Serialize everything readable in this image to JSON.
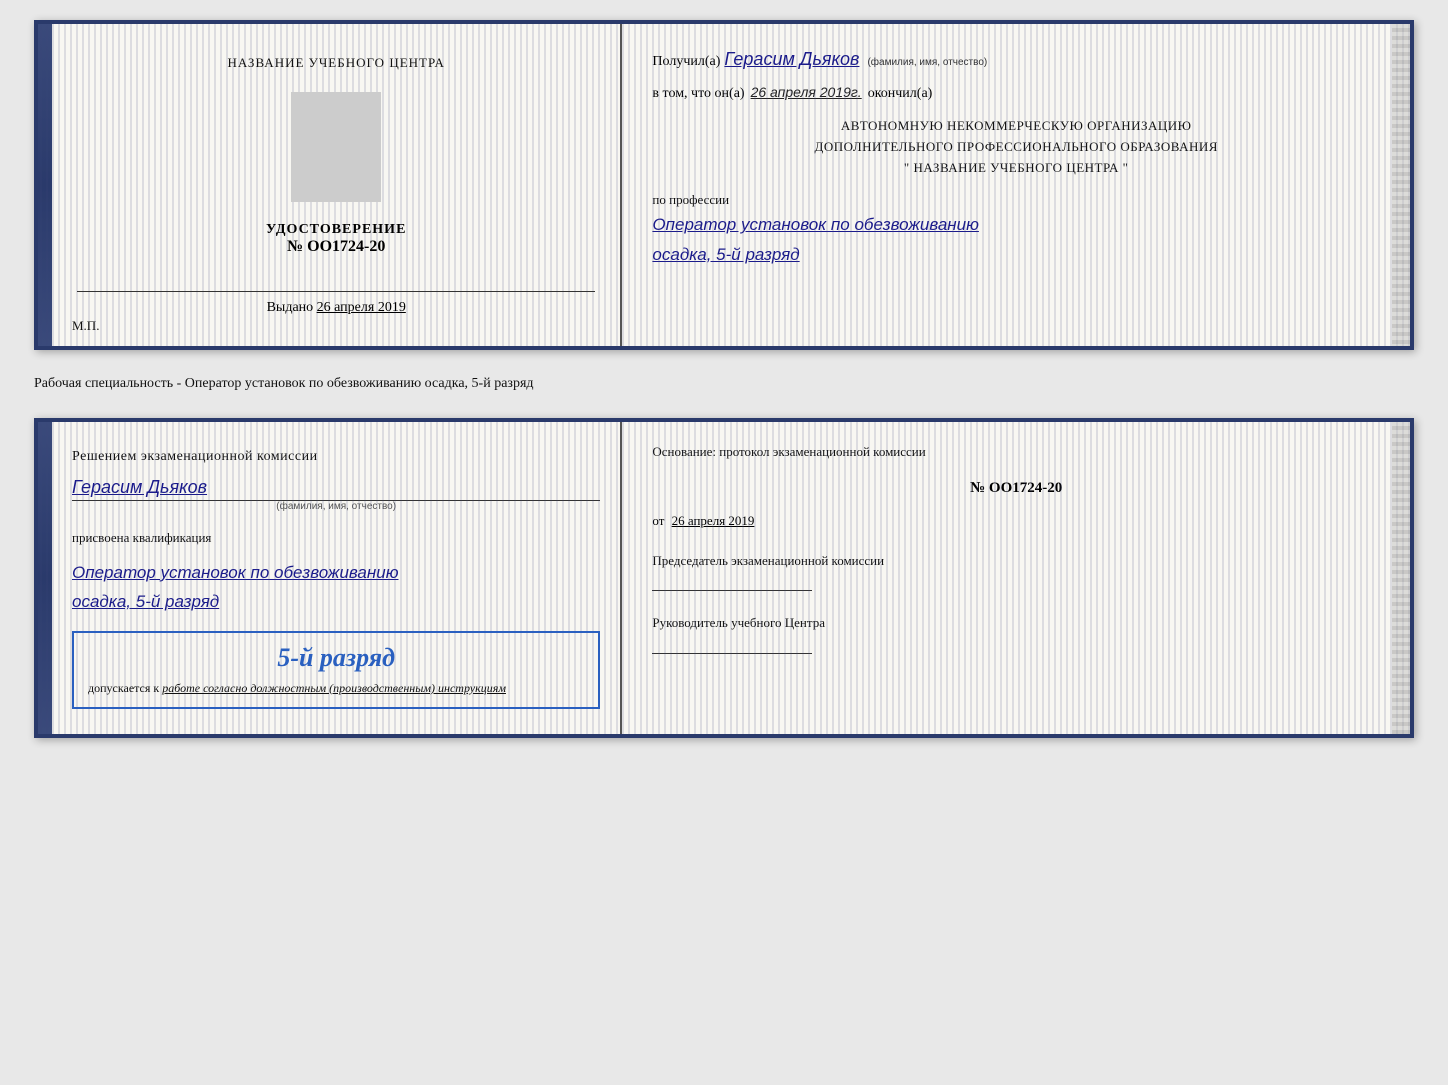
{
  "card1": {
    "left": {
      "center_name": "НАЗВАНИЕ УЧЕБНОГО ЦЕНТРА",
      "cert_label": "УДОСТОВЕРЕНИЕ",
      "cert_number": "№ OO1724-20",
      "vydano_label": "Выдано",
      "vydano_date": "26 апреля 2019",
      "mp_label": "М.П."
    },
    "right": {
      "recipient_prefix": "Получил(а)",
      "recipient_name": "Герасим Дьяков",
      "recipient_sub": "(фамилия, имя, отчество)",
      "vtom_text": "в том, что он(а)",
      "vtom_date": "26 апреля 2019г.",
      "okoncil": "окончил(а)",
      "org_line1": "АВТОНОМНУЮ НЕКОММЕРЧЕСКУЮ ОРГАНИЗАЦИЮ",
      "org_line2": "ДОПОЛНИТЕЛЬНОГО ПРОФЕССИОНАЛЬНОГО ОБРАЗОВАНИЯ",
      "org_line3": "\"   НАЗВАНИЕ УЧЕБНОГО ЦЕНТРА   \"",
      "po_professii": "по профессии",
      "profession_line1": "Оператор установок по обезвоживанию",
      "profession_line2": "осадка, 5-й разряд"
    }
  },
  "separator": {
    "text": "Рабочая специальность - Оператор установок по обезвоживанию осадка, 5-й разряд"
  },
  "card2": {
    "left": {
      "resheniem_title": "Решением экзаменационной комиссии",
      "person_name": "Герасим Дьяков",
      "person_sub": "(фамилия, имя, отчество)",
      "prisvoena": "присвоена квалификация",
      "qualification1": "Оператор установок по обезвоживанию",
      "qualification2": "осадка, 5-й разряд",
      "stamp_title": "5-й разряд",
      "stamp_text": "допускается к",
      "stamp_italic": "работе согласно должностным (производственным) инструкциям"
    },
    "right": {
      "osnov_label": "Основание: протокол экзаменационной комиссии",
      "protocol_number": "№ OO1724-20",
      "ot_label": "от",
      "ot_date": "26 апреля 2019",
      "chairman_label": "Председатель экзаменационной комиссии",
      "rukovoditel_label": "Руководитель учебного Центра"
    }
  }
}
